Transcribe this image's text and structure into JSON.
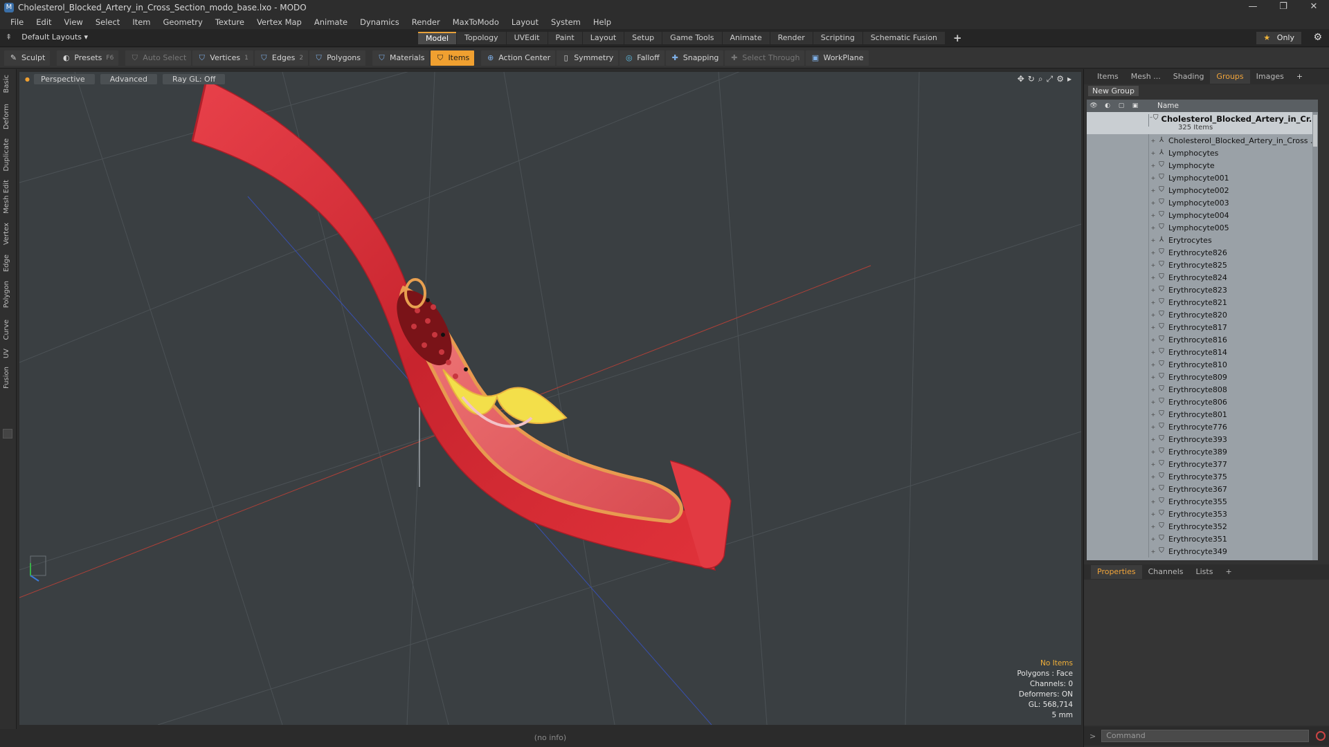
{
  "window": {
    "title": "Cholesterol_Blocked_Artery_in_Cross_Section_modo_base.lxo - MODO",
    "app_icon": "modo-icon",
    "controls": [
      "—",
      "❐",
      "✕"
    ]
  },
  "menu": [
    "File",
    "Edit",
    "View",
    "Select",
    "Item",
    "Geometry",
    "Texture",
    "Vertex Map",
    "Animate",
    "Dynamics",
    "Render",
    "MaxToModo",
    "Layout",
    "System",
    "Help"
  ],
  "layoutbar": {
    "layout_label": "Default Layouts ▾",
    "tabs": [
      "Model",
      "Topology",
      "UVEdit",
      "Paint",
      "Layout",
      "Setup",
      "Game Tools",
      "Animate",
      "Render",
      "Scripting",
      "Schematic Fusion"
    ],
    "active_tab": "Model",
    "add_tab": "+",
    "only_label": "Only"
  },
  "toolbar": {
    "sculpt": "Sculpt",
    "presets": "Presets",
    "presets_key": "F6",
    "auto_select": "Auto Select",
    "vertices": "Vertices",
    "vertices_count": "1",
    "edges": "Edges",
    "edges_count": "2",
    "polygons": "Polygons",
    "materials": "Materials",
    "items": "Items",
    "action_center": "Action Center",
    "symmetry": "Symmetry",
    "falloff": "Falloff",
    "snapping": "Snapping",
    "select_through": "Select Through",
    "workplane": "WorkPlane"
  },
  "left_tabs": [
    "Basic",
    "Deform",
    "Duplicate",
    "Mesh Edit",
    "Vertex",
    "Edge",
    "Polygon",
    "Curve",
    "UV",
    "Fusion"
  ],
  "viewport": {
    "view_mode": "Perspective",
    "advanced": "Advanced",
    "raygl": "Ray GL: Off",
    "info": {
      "no_items": "No Items",
      "polygons": "Polygons : Face",
      "channels": "Channels: 0",
      "deformers": "Deformers: ON",
      "gl": "GL: 568,714",
      "scale": "5 mm"
    },
    "colors": {
      "background": "#3a3f42",
      "artery": "#e0323a",
      "plaque": "#f5e04a",
      "grid_x": "#c0453a",
      "grid_z": "#3a55b8"
    }
  },
  "status": "(no info)",
  "right_panel": {
    "tabs": [
      "Items",
      "Mesh ...",
      "Shading",
      "Groups",
      "Images",
      "+"
    ],
    "active_tab": "Groups",
    "new_group": "New Group",
    "name_header": "Name",
    "group_name": "Cholesterol_Blocked_Artery_in_Cr...",
    "group_count": "325 Items",
    "rows": [
      {
        "label": "Cholesterol_Blocked_Artery_in_Cross ...",
        "icon": "locator-icon"
      },
      {
        "label": "Lymphocytes",
        "icon": "locator-icon"
      },
      {
        "label": "Lymphocyte",
        "icon": "mesh-icon"
      },
      {
        "label": "Lymphocyte001",
        "icon": "mesh-icon"
      },
      {
        "label": "Lymphocyte002",
        "icon": "mesh-icon"
      },
      {
        "label": "Lymphocyte003",
        "icon": "mesh-icon"
      },
      {
        "label": "Lymphocyte004",
        "icon": "mesh-icon"
      },
      {
        "label": "Lymphocyte005",
        "icon": "mesh-icon"
      },
      {
        "label": "Erytrocytes",
        "icon": "locator-icon"
      },
      {
        "label": "Erythrocyte826",
        "icon": "mesh-icon"
      },
      {
        "label": "Erythrocyte825",
        "icon": "mesh-icon"
      },
      {
        "label": "Erythrocyte824",
        "icon": "mesh-icon"
      },
      {
        "label": "Erythrocyte823",
        "icon": "mesh-icon"
      },
      {
        "label": "Erythrocyte821",
        "icon": "mesh-icon"
      },
      {
        "label": "Erythrocyte820",
        "icon": "mesh-icon"
      },
      {
        "label": "Erythrocyte817",
        "icon": "mesh-icon"
      },
      {
        "label": "Erythrocyte816",
        "icon": "mesh-icon"
      },
      {
        "label": "Erythrocyte814",
        "icon": "mesh-icon"
      },
      {
        "label": "Erythrocyte810",
        "icon": "mesh-icon"
      },
      {
        "label": "Erythrocyte809",
        "icon": "mesh-icon"
      },
      {
        "label": "Erythrocyte808",
        "icon": "mesh-icon"
      },
      {
        "label": "Erythrocyte806",
        "icon": "mesh-icon"
      },
      {
        "label": "Erythrocyte801",
        "icon": "mesh-icon"
      },
      {
        "label": "Erythrocyte776",
        "icon": "mesh-icon"
      },
      {
        "label": "Erythrocyte393",
        "icon": "mesh-icon"
      },
      {
        "label": "Erythrocyte389",
        "icon": "mesh-icon"
      },
      {
        "label": "Erythrocyte377",
        "icon": "mesh-icon"
      },
      {
        "label": "Erythrocyte375",
        "icon": "mesh-icon"
      },
      {
        "label": "Erythrocyte367",
        "icon": "mesh-icon"
      },
      {
        "label": "Erythrocyte355",
        "icon": "mesh-icon"
      },
      {
        "label": "Erythrocyte353",
        "icon": "mesh-icon"
      },
      {
        "label": "Erythrocyte352",
        "icon": "mesh-icon"
      },
      {
        "label": "Erythrocyte351",
        "icon": "mesh-icon"
      },
      {
        "label": "Erythrocyte349",
        "icon": "mesh-icon"
      }
    ],
    "props_tabs": [
      "Properties",
      "Channels",
      "Lists",
      "+"
    ],
    "props_active": "Properties",
    "command_placeholder": "Command"
  }
}
